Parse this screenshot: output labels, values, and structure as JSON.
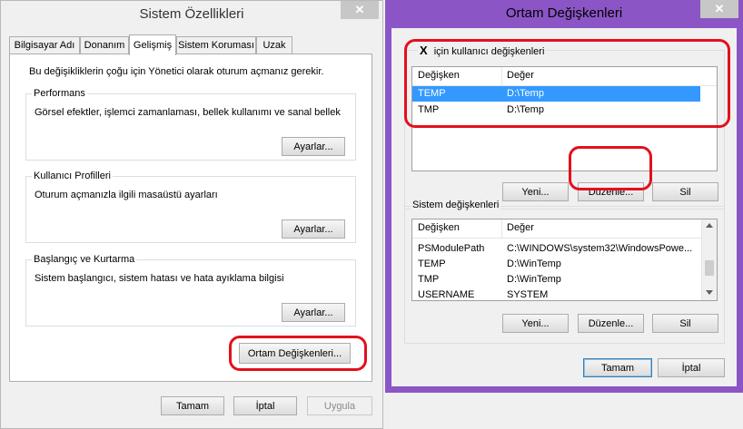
{
  "left_window": {
    "title": "Sistem Özellikleri",
    "close_glyph": "✕",
    "tabs": [
      {
        "label": "Bilgisayar Adı"
      },
      {
        "label": "Donanım"
      },
      {
        "label": "Gelişmiş"
      },
      {
        "label": "Sistem Koruması"
      },
      {
        "label": "Uzak"
      }
    ],
    "active_tab": "Gelişmiş",
    "admin_note": "Bu değişikliklerin çoğu için Yönetici olarak oturum açmanız gerekir.",
    "performance": {
      "legend": "Performans",
      "description": "Görsel efektler, işlemci zamanlaması, bellek kullanımı ve sanal bellek",
      "button": "Ayarlar..."
    },
    "user_profiles": {
      "legend": "Kullanıcı Profilleri",
      "description": "Oturum açmanızla ilgili masaüstü ayarları",
      "button": "Ayarlar..."
    },
    "startup_recovery": {
      "legend": "Başlangıç ve Kurtarma",
      "description": "Sistem başlangıcı, sistem hatası ve hata ayıklama bilgisi",
      "button": "Ayarlar..."
    },
    "env_vars_button": "Ortam Değişkenleri...",
    "footer": {
      "ok": "Tamam",
      "cancel": "İptal",
      "apply": "Uygula"
    }
  },
  "right_window": {
    "title": "Ortam Değişkenleri",
    "close_glyph": "✕",
    "accent_color": "#8b55c6",
    "user_vars": {
      "legend_bold": "X",
      "legend_rest": "için kullanıcı değişkenleri",
      "columns": {
        "name": "Değişken",
        "value": "Değer"
      },
      "rows": [
        {
          "name": "TEMP",
          "value": "D:\\Temp",
          "selected": true
        },
        {
          "name": "TMP",
          "value": "D:\\Temp",
          "selected": false
        }
      ],
      "buttons": {
        "new": "Yeni...",
        "edit": "Düzenle...",
        "delete": "Sil"
      }
    },
    "system_vars": {
      "legend": "Sistem değişkenleri",
      "columns": {
        "name": "Değişken",
        "value": "Değer"
      },
      "rows": [
        {
          "name": "PSModulePath",
          "value": "C:\\WINDOWS\\system32\\WindowsPowe..."
        },
        {
          "name": "TEMP",
          "value": "D:\\WinTemp"
        },
        {
          "name": "TMP",
          "value": "D:\\WinTemp"
        },
        {
          "name": "USERNAME",
          "value": "SYSTEM"
        }
      ],
      "buttons": {
        "new": "Yeni...",
        "edit": "Düzenle...",
        "delete": "Sil"
      }
    },
    "footer": {
      "ok": "Tamam",
      "cancel": "İptal"
    }
  },
  "highlight_color": "#e3101d"
}
